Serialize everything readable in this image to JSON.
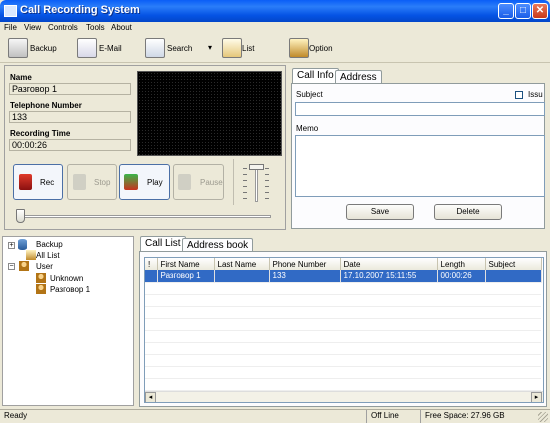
{
  "window": {
    "title": "Call Recording System",
    "btn_min": "_",
    "btn_max": "□",
    "btn_close": "✕"
  },
  "menu": [
    "File",
    "View",
    "Controls",
    "Tools",
    "About"
  ],
  "toolbar": {
    "backup": "Backup",
    "email": "E-Mail",
    "search": "Search",
    "search_arrow": "▾",
    "list": "List",
    "option": "Option"
  },
  "info": {
    "name_label": "Name",
    "name_value": "Разговор 1",
    "tel_label": "Telephone Number",
    "tel_value": "133",
    "time_label": "Recording Time",
    "time_value": "00:00:26"
  },
  "controls": {
    "rec": "Rec",
    "stop": "Stop",
    "play": "Play",
    "pause": "Pause"
  },
  "callinfo": {
    "tab_info": "Call Info",
    "tab_address": "Address",
    "subject_label": "Subject",
    "issue_label": "Issu",
    "subject_value": "",
    "memo_label": "Memo",
    "memo_value": "",
    "save": "Save",
    "delete": "Delete"
  },
  "tree": {
    "backup": "Backup",
    "all_list": "All List",
    "user": "User",
    "unknown": "Unknown",
    "conversation": "Разговор 1",
    "exp_plus": "+",
    "exp_minus": "−"
  },
  "list": {
    "tab_calls": "Call List",
    "tab_book": "Address book",
    "columns": [
      "!",
      "First Name",
      "Last Name",
      "Phone Number",
      "Date",
      "Length",
      "Subject"
    ],
    "rows": [
      {
        "flag": "",
        "first": "Разговор 1",
        "last": "",
        "phone": "133",
        "date": "17.10.2007 15:11:55",
        "length": "00:00:26",
        "subject": ""
      }
    ]
  },
  "scrollbar": {
    "left": "◂",
    "right": "▸"
  },
  "status": {
    "ready": "Ready",
    "line": "Off Line",
    "space": "Free Space: 27.96 GB"
  }
}
